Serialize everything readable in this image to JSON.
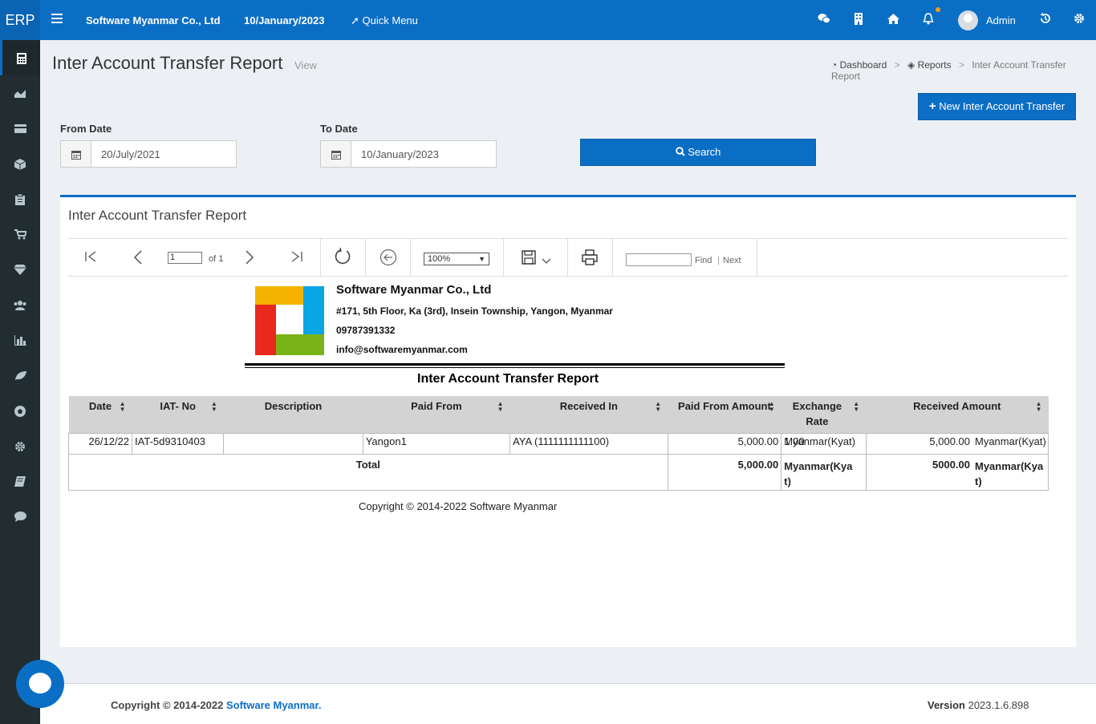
{
  "topbar": {
    "brand": "ERP",
    "company": "Software Myanmar Co., Ltd",
    "date": "10/January/2023",
    "quick_menu": "Quick Menu",
    "user": "Admin",
    "icons": [
      "wechat-icon",
      "building-icon",
      "home-icon",
      "bell-icon",
      "history-icon",
      "gear-icon"
    ]
  },
  "sidebar": {
    "items": [
      "calculator-icon",
      "area-chart-icon",
      "credit-card-icon",
      "cube-icon",
      "clipboard-icon",
      "cart-icon",
      "diamond-icon",
      "users-icon",
      "bar-chart-icon",
      "leaf-icon",
      "football-icon",
      "cog-icon",
      "book-icon",
      "comment-icon"
    ]
  },
  "page": {
    "title": "Inter Account Transfer Report",
    "subtitle": "View",
    "breadcrumb": [
      "Dashboard",
      "Reports",
      "Inter Account Transfer Report"
    ]
  },
  "actions": {
    "new_button": "New Inter Account Transfer",
    "search_button": "Search"
  },
  "filters": {
    "from_label": "From Date",
    "from_value": "20/July/2021",
    "to_label": "To Date",
    "to_value": "10/January/2023"
  },
  "box": {
    "title": "Inter Account Transfer Report"
  },
  "viewer": {
    "page_input": "1",
    "of_pages": "of 1",
    "zoom": "100%",
    "find": "Find",
    "next": "Next"
  },
  "report": {
    "company": "Software Myanmar Co., Ltd",
    "address": "#171, 5th Floor, Ka (3rd), Insein Township, Yangon, Myanmar",
    "phone": "09787391332",
    "email": "info@softwaremyanmar.com",
    "title": "Inter Account Transfer Report",
    "columns": [
      "Date",
      "IAT- No",
      "Description",
      "Paid From",
      "Received In",
      "Paid From Amount",
      "Exchange Rate",
      "Received Amount"
    ],
    "rows": [
      {
        "date": "26/12/22",
        "iat_no": "IAT-5d9310403",
        "description": "",
        "paid_from": "Yangon1",
        "received_in": "AYA (1111111111100)",
        "paid_amount": "5,000.00",
        "paid_currency": "Myanmar(Kyat)",
        "rate": "1.00",
        "received_amount": "5,000.00",
        "received_currency": "Myanmar(Kyat)"
      }
    ],
    "total": {
      "label": "Total",
      "paid_amount": "5,000.00",
      "paid_currency": "Myanmar(Kyat)",
      "received_amount": "5000.00",
      "received_currency": "Myanmar(Kyat)"
    },
    "copyright": "Copyright © 2014-2022 Software Myanmar"
  },
  "footer": {
    "copyright": "Copyright © 2014-2022",
    "company_link": "Software Myanmar.",
    "version_label": "Version",
    "version": "2023.1.6.898"
  },
  "colors": {
    "primary": "#0b6ec5",
    "sidebar": "#222d32",
    "header_gray": "#d3d3d3"
  }
}
